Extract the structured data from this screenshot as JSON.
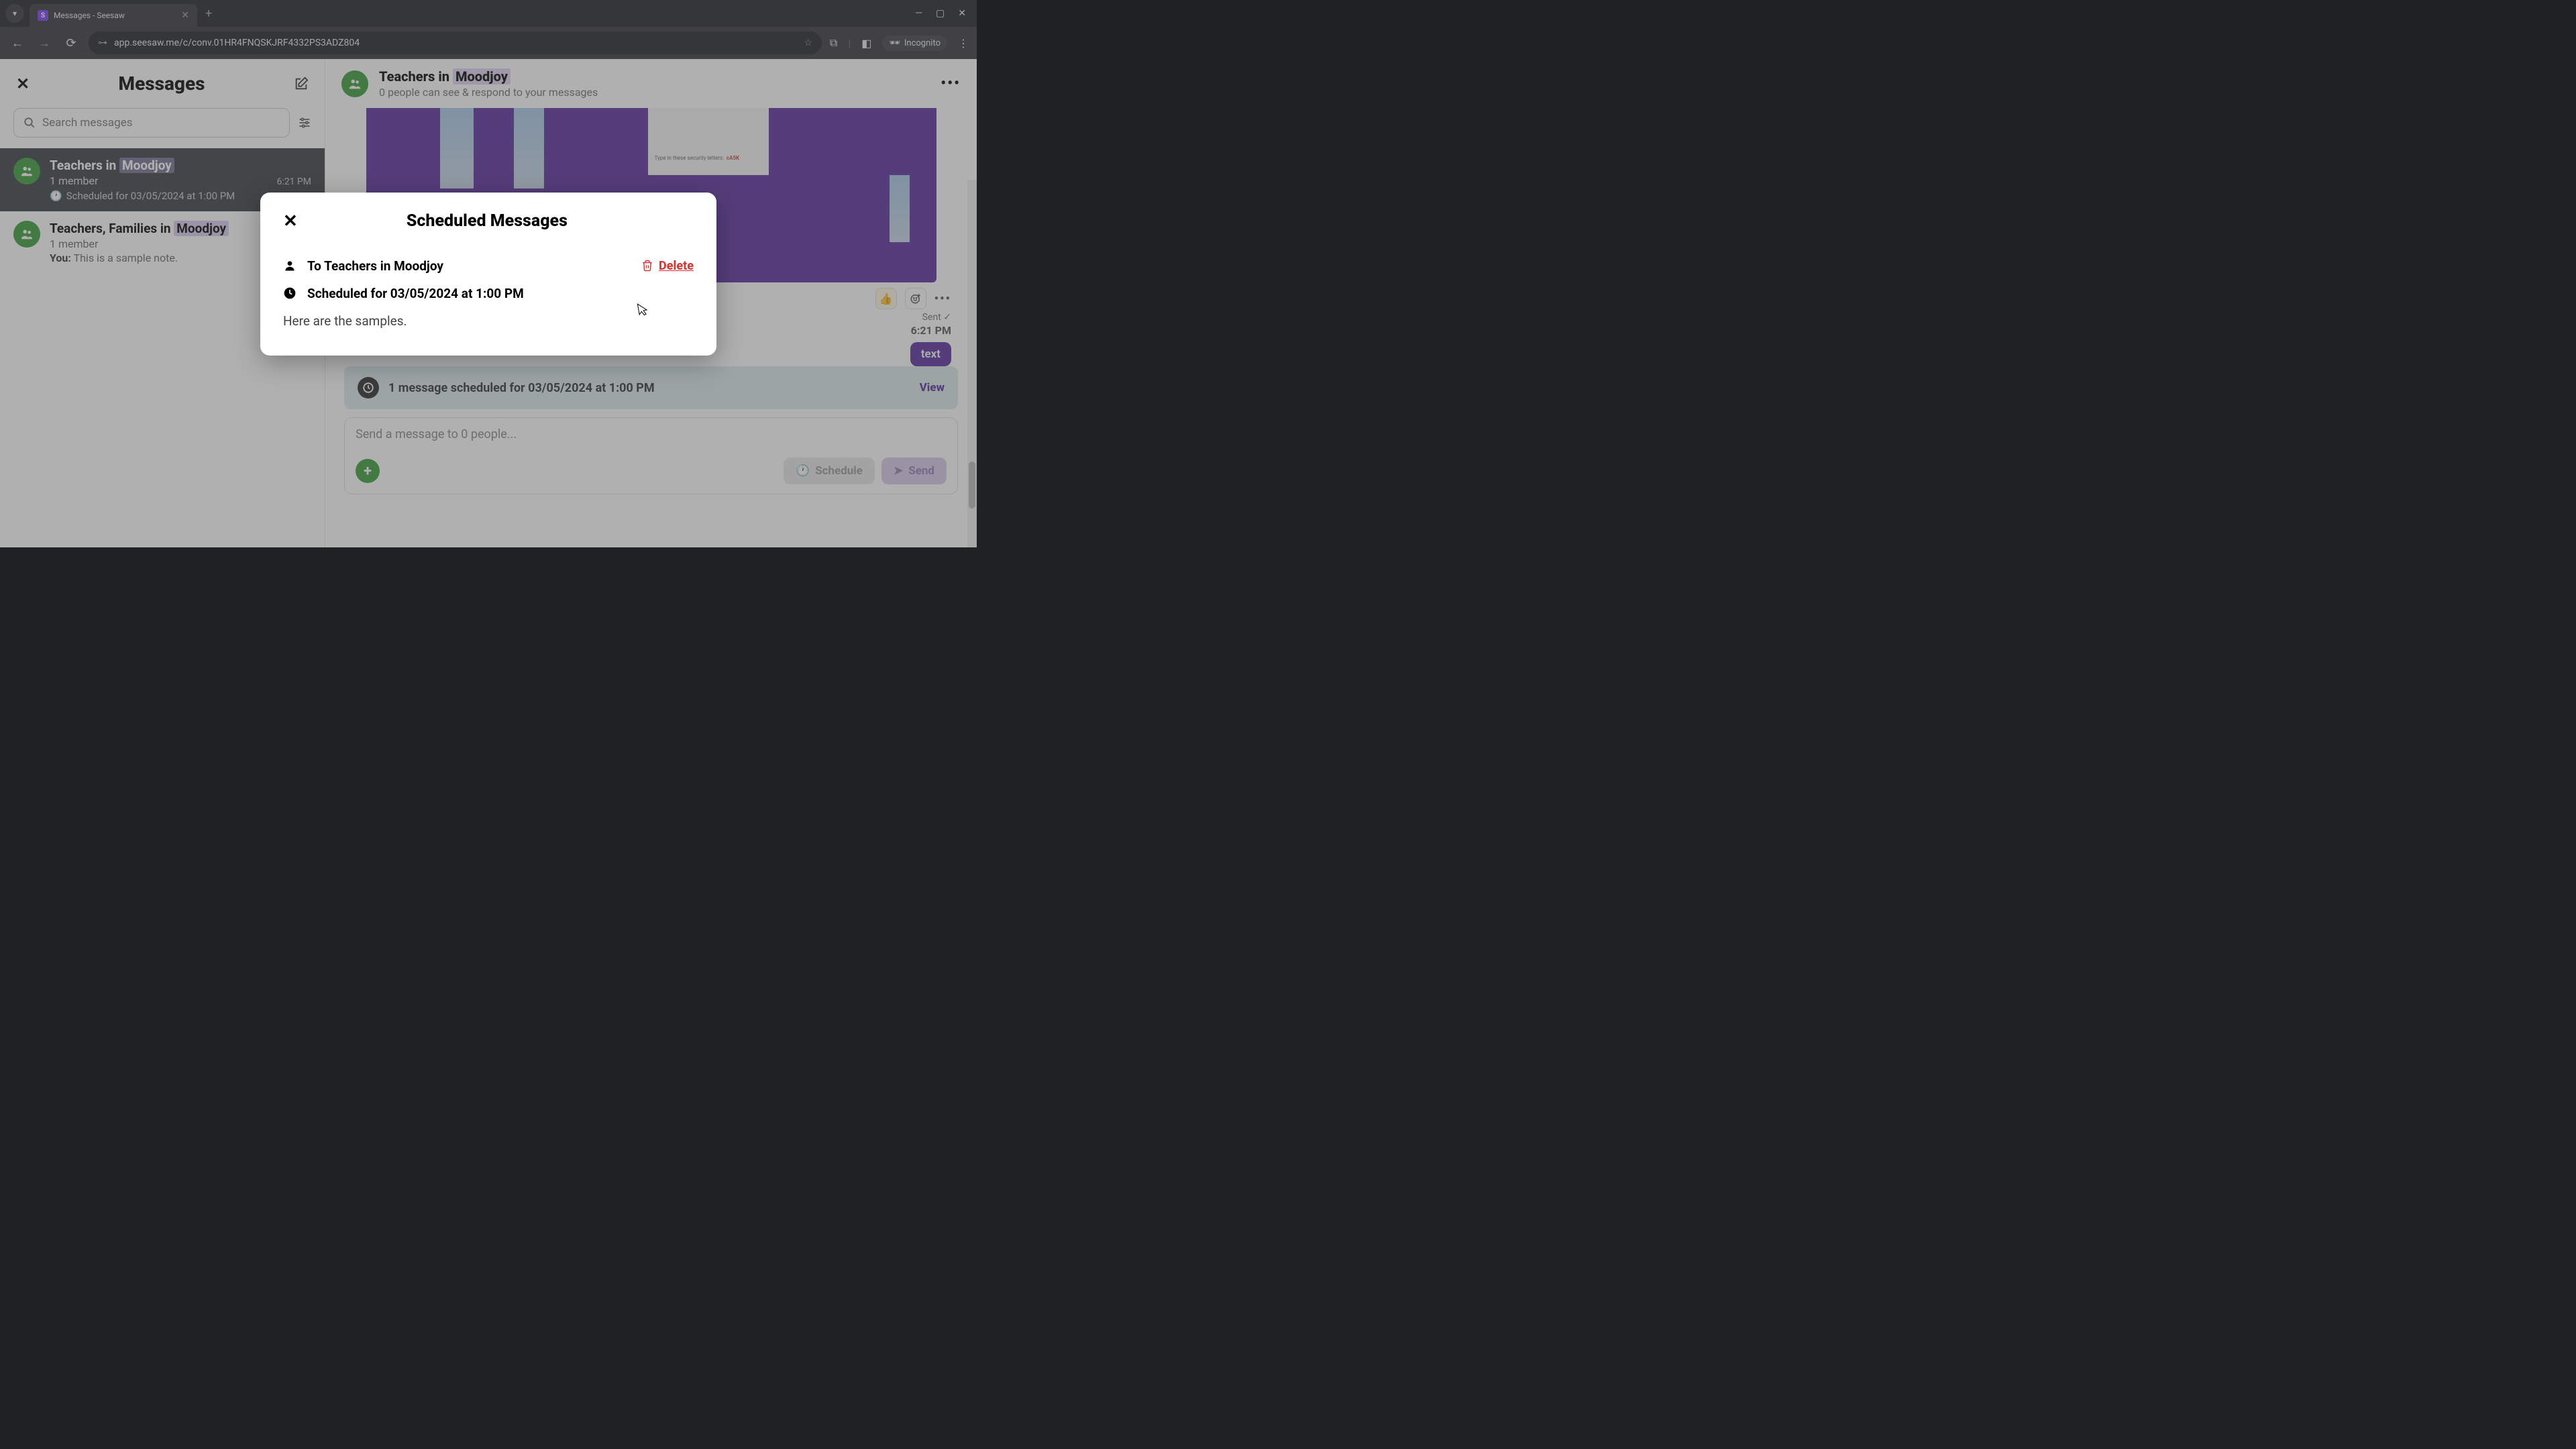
{
  "browser": {
    "tab_title": "Messages - Seesaw",
    "url": "app.seesaw.me/c/conv.01HR4FNQSKJRF4332PS3ADZ804",
    "incognito_label": "Incognito"
  },
  "sidebar": {
    "title": "Messages",
    "search_placeholder": "Search messages",
    "conversations": [
      {
        "title_prefix": "Teachers in ",
        "title_hl": "Moodjoy",
        "members": "1 member",
        "time": "6:21 PM",
        "scheduled": "Scheduled for 03/05/2024 at 1:00 PM",
        "active": true
      },
      {
        "title_prefix": "Teachers, Families in ",
        "title_hl": "Moodjoy",
        "members": "1 member",
        "you_label": "You:",
        "preview": " This is a sample note.",
        "active": false
      }
    ]
  },
  "chat": {
    "title_prefix": "Teachers in ",
    "title_hl": "Moodjoy",
    "subtitle": "0 people can see & respond to your messages",
    "security_text": "Type in these security letters:",
    "captcha": "cA5K",
    "reactions": {
      "thumb": "👍",
      "smile": "😊"
    },
    "status": "Sent ✓",
    "time": "6:21 PM",
    "bubble_text": "text",
    "scheduled_banner": "1 message scheduled for 03/05/2024 at 1:00 PM",
    "view_label": "View",
    "composer_placeholder": "Send a message to 0 people...",
    "schedule_label": "Schedule",
    "send_label": "Send"
  },
  "modal": {
    "title": "Scheduled Messages",
    "to_line": "To Teachers in Moodjoy",
    "delete_label": "Delete",
    "scheduled_line": "Scheduled for 03/05/2024 at 1:00 PM",
    "body": "Here are the samples."
  }
}
